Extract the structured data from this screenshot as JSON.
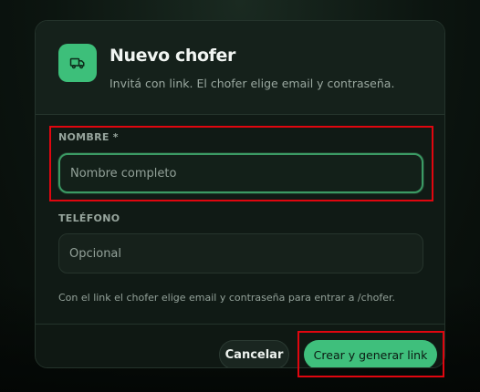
{
  "dialog": {
    "title": "Nuevo chofer",
    "subtitle": "Invitá con link. El chofer elige email y contraseña.",
    "icon": "truck-icon",
    "accent_color": "#3fbf7c"
  },
  "form": {
    "name": {
      "label": "NOMBRE *",
      "placeholder": "Nombre completo",
      "value": ""
    },
    "phone": {
      "label": "TELÉFONO",
      "placeholder": "Opcional",
      "value": ""
    },
    "hint": "Con el link el chofer elige email y contraseña para entrar a /chofer."
  },
  "actions": {
    "cancel_label": "Cancelar",
    "submit_label": "Crear y generar link"
  },
  "highlight_color": "#e0060f"
}
